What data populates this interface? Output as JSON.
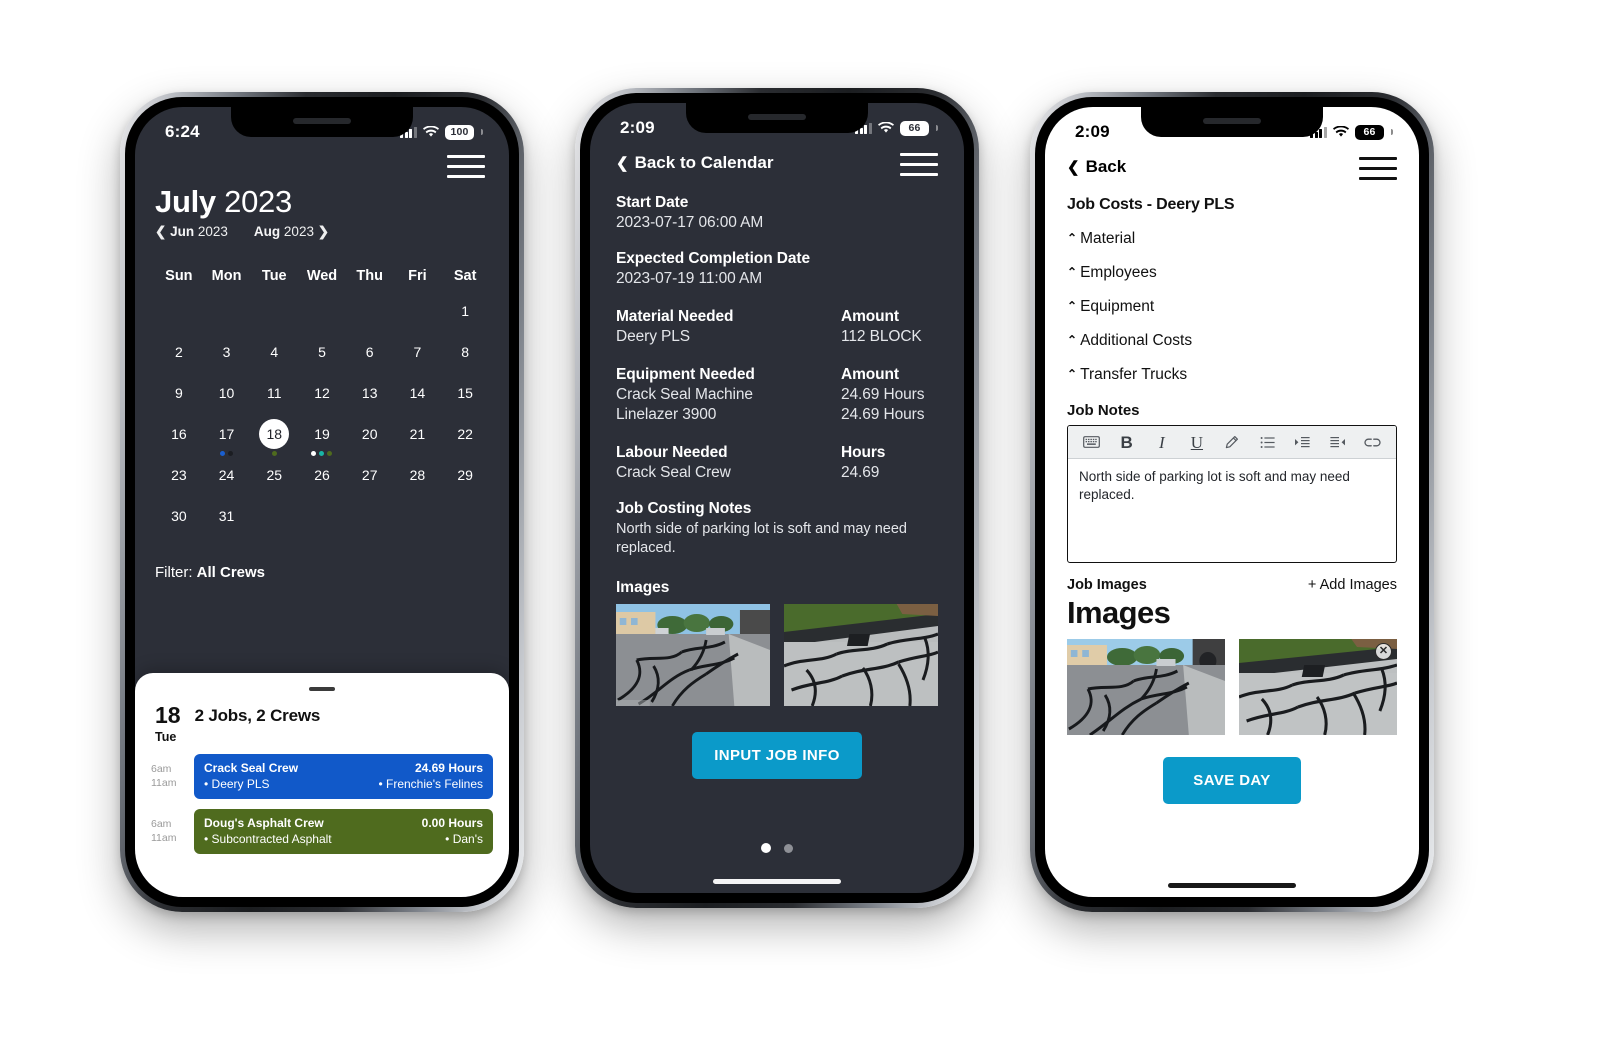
{
  "phones": [
    {
      "id": "calendar",
      "theme": "dark",
      "status": {
        "time": "6:24",
        "battery": "100",
        "wifi_icon": "wifi-icon",
        "signal_icon": "cellular-signal-icon"
      },
      "menu_icon": "hamburger-menu-icon",
      "calendar": {
        "month": "July",
        "year": "2023",
        "prev_label": "Jun",
        "prev_year": "2023",
        "next_label": "Aug",
        "next_year": "2023",
        "prev_icon": "chevron-left-icon",
        "next_icon": "chevron-right-icon",
        "dow": [
          "Sun",
          "Mon",
          "Tue",
          "Wed",
          "Thu",
          "Fri",
          "Sat"
        ],
        "weeks": [
          [
            {
              "day": ""
            },
            {
              "day": ""
            },
            {
              "day": ""
            },
            {
              "day": ""
            },
            {
              "day": ""
            },
            {
              "day": ""
            },
            {
              "day": "1"
            }
          ],
          [
            {
              "day": "2"
            },
            {
              "day": "3"
            },
            {
              "day": "4"
            },
            {
              "day": "5"
            },
            {
              "day": "6"
            },
            {
              "day": "7"
            },
            {
              "day": "8"
            }
          ],
          [
            {
              "day": "9"
            },
            {
              "day": "10"
            },
            {
              "day": "11"
            },
            {
              "day": "12"
            },
            {
              "day": "13"
            },
            {
              "day": "14"
            },
            {
              "day": "15"
            }
          ],
          [
            {
              "day": "16"
            },
            {
              "day": "17",
              "dots": [
                "#1a5fd0",
                "#1b1d22"
              ]
            },
            {
              "day": "18",
              "today": true,
              "dots": [
                "#4f6b1e"
              ]
            },
            {
              "day": "19",
              "dots": [
                "#ffffff",
                "#19b5a6",
                "#4f6b1e"
              ]
            },
            {
              "day": "20"
            },
            {
              "day": "21"
            },
            {
              "day": "22"
            }
          ],
          [
            {
              "day": "23"
            },
            {
              "day": "24"
            },
            {
              "day": "25"
            },
            {
              "day": "26"
            },
            {
              "day": "27"
            },
            {
              "day": "28"
            },
            {
              "day": "29"
            }
          ],
          [
            {
              "day": "30"
            },
            {
              "day": "31"
            },
            {
              "day": ""
            },
            {
              "day": ""
            },
            {
              "day": ""
            },
            {
              "day": ""
            },
            {
              "day": ""
            }
          ]
        ],
        "filter_label": "Filter:",
        "filter_value": "All Crews"
      },
      "sheet": {
        "grab_handle": "drag-handle",
        "day_number": "18",
        "day_weekday": "Tue",
        "summary": "2 Jobs, 2 Crews",
        "jobs": [
          {
            "start": "6am",
            "end": "11am",
            "crew": "Crack Seal Crew",
            "hours": "24.69 Hours",
            "material": "• Deery PLS",
            "client": "• Frenchie's Felines",
            "color": "#1159c9"
          },
          {
            "start": "6am",
            "end": "11am",
            "crew": "Doug's Asphalt Crew",
            "hours": "0.00 Hours",
            "material": "• Subcontracted Asphalt",
            "client": "• Dan's",
            "color": "#4f6b1e"
          }
        ]
      }
    },
    {
      "id": "job-detail",
      "theme": "dark",
      "status": {
        "time": "2:09",
        "battery": "66",
        "wifi_icon": "wifi-icon",
        "signal_icon": "cellular-signal-icon"
      },
      "menu_icon": "hamburger-menu-icon",
      "back_label": "Back to Calendar",
      "back_icon": "chevron-left-icon",
      "fields": [
        {
          "label": "Start Date",
          "value": "2023-07-17 06:00 AM"
        },
        {
          "label": "Expected Completion Date",
          "value": "2023-07-19 11:00 AM"
        }
      ],
      "material": {
        "left_label": "Material Needed",
        "right_label": "Amount",
        "rows": [
          {
            "name": "Deery PLS",
            "amount": "112 BLOCK"
          }
        ]
      },
      "equipment": {
        "left_label": "Equipment Needed",
        "right_label": "Amount",
        "rows": [
          {
            "name": "Crack Seal Machine",
            "amount": "24.69 Hours"
          },
          {
            "name": "Linelazer 3900",
            "amount": "24.69 Hours"
          }
        ]
      },
      "labour": {
        "left_label": "Labour Needed",
        "right_label": "Hours",
        "rows": [
          {
            "name": "Crack Seal Crew",
            "amount": "24.69"
          }
        ]
      },
      "notes": {
        "label": "Job Costing Notes",
        "text": "North side of parking lot is soft and may need replaced."
      },
      "images_label": "Images",
      "images": [
        {
          "alt_name": "cracked-parking-lot-photo-1"
        },
        {
          "alt_name": "cracked-asphalt-curb-photo-2"
        }
      ],
      "cta": "INPUT JOB INFO",
      "cta_color": "#0b9ac9",
      "page_dots": {
        "count": 2,
        "active_index": 0
      }
    },
    {
      "id": "job-costs",
      "theme": "light",
      "status": {
        "time": "2:09",
        "battery": "66",
        "wifi_icon": "wifi-icon",
        "signal_icon": "cellular-signal-icon"
      },
      "menu_icon": "hamburger-menu-icon",
      "back_label": "Back",
      "back_icon": "chevron-left-icon",
      "heading": "Job Costs - Deery PLS",
      "accordions": [
        {
          "label": "Material",
          "icon": "chevron-up-icon"
        },
        {
          "label": "Employees",
          "icon": "chevron-up-icon"
        },
        {
          "label": "Equipment",
          "icon": "chevron-up-icon"
        },
        {
          "label": "Additional Costs",
          "icon": "chevron-up-icon"
        },
        {
          "label": "Transfer Trucks",
          "icon": "chevron-up-icon"
        }
      ],
      "notes": {
        "label": "Job Notes",
        "toolbar": [
          "keyboard-icon",
          "bold-icon",
          "italic-icon",
          "underline-icon",
          "highlighter-icon",
          "bullet-list-icon",
          "indent-right-icon",
          "indent-left-icon",
          "link-icon"
        ],
        "body": "North side of parking lot is soft and may need replaced."
      },
      "job_images": {
        "label": "Job Images",
        "add_label": "+ Add Images",
        "big_title": "Images",
        "items": [
          {
            "alt_name": "cracked-parking-lot-photo-1",
            "removable": false
          },
          {
            "alt_name": "cracked-asphalt-curb-photo-2",
            "removable": true,
            "remove_icon": "close-circle-icon"
          }
        ]
      },
      "cta": "SAVE DAY",
      "cta_color": "#0b9ac9"
    }
  ]
}
